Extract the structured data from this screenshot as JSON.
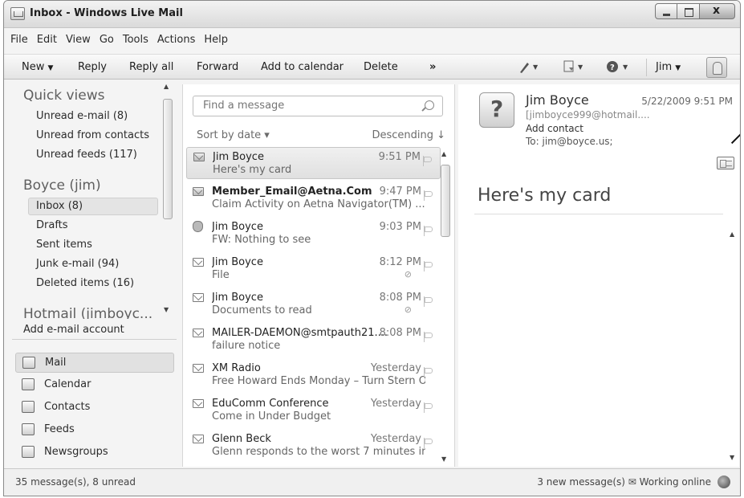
{
  "window": {
    "title": "Inbox - Windows Live Mail"
  },
  "menu": [
    "File",
    "Edit",
    "View",
    "Go",
    "Tools",
    "Actions",
    "Help"
  ],
  "toolbar": {
    "new_label": "New",
    "reply_label": "Reply",
    "reply_all_label": "Reply all",
    "forward_label": "Forward",
    "add_calendar_label": "Add to calendar",
    "delete_label": "Delete",
    "more_label": "»",
    "user_label": "Jim"
  },
  "sidebar": {
    "quick_views_heading": "Quick views",
    "quick_views": [
      {
        "label": "Unread e-mail  (8)"
      },
      {
        "label": "Unread from contacts"
      },
      {
        "label": "Unread feeds  (117)"
      }
    ],
    "account_heading": "Boyce (jim)",
    "folders": [
      {
        "label": "Inbox  (8)"
      },
      {
        "label": "Drafts"
      },
      {
        "label": "Sent items"
      },
      {
        "label": "Junk e-mail  (94)"
      },
      {
        "label": "Deleted items  (16)"
      }
    ],
    "hotmail_heading": "Hotmail (jimboyc...",
    "add_account": "Add e-mail account",
    "nav": [
      {
        "label": "Mail",
        "icon": "mail-icon"
      },
      {
        "label": "Calendar",
        "icon": "calendar-icon"
      },
      {
        "label": "Contacts",
        "icon": "contacts-icon"
      },
      {
        "label": "Feeds",
        "icon": "feeds-icon"
      },
      {
        "label": "Newsgroups",
        "icon": "newsgroups-icon"
      }
    ]
  },
  "search": {
    "placeholder": "Find a message"
  },
  "sort": {
    "by": "Sort by date ▾",
    "order": "Descending ↓"
  },
  "messages": [
    {
      "from": "Jim Boyce",
      "time": "9:51 PM",
      "subject": "Here's my card"
    },
    {
      "from": "Member_Email@Aetna.Com",
      "time": "9:47 PM",
      "subject": "Claim Activity on Aetna Navigator(TM)  ..."
    },
    {
      "from": "Jim Boyce",
      "time": "9:03 PM",
      "subject": "FW: Nothing to see"
    },
    {
      "from": "Jim Boyce",
      "time": "8:12 PM",
      "subject": "File"
    },
    {
      "from": "Jim Boyce",
      "time": "8:08 PM",
      "subject": "Documents to read"
    },
    {
      "from": "MAILER-DAEMON@smtpauth21....",
      "time": "8:08 PM",
      "subject": "failure notice"
    },
    {
      "from": "XM Radio",
      "time": "Yesterday",
      "subject": "Free Howard Ends Monday – Turn Stern O..."
    },
    {
      "from": "EduComm Conference",
      "time": "Yesterday",
      "subject": "Come in Under Budget"
    },
    {
      "from": "Glenn Beck",
      "time": "Yesterday",
      "subject": "Glenn responds to the worst 7 minutes in ..."
    }
  ],
  "reading": {
    "avatar": "?",
    "from": "Jim Boyce",
    "date": "5/22/2009 9:51 PM",
    "email": "[jimboyce999@hotmail....",
    "add_contact": "Add contact",
    "to": "To:  jim@boyce.us;",
    "subject": "Here's my card"
  },
  "status": {
    "left": "35 message(s), 8 unread",
    "right": "3 new message(s) ✉ Working online"
  }
}
